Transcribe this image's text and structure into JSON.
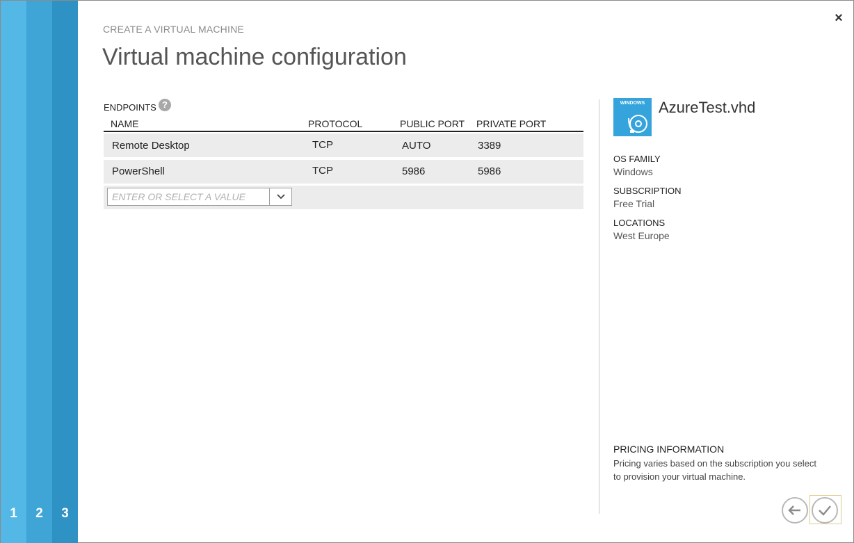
{
  "wizard": {
    "steps": [
      "1",
      "2",
      "3"
    ],
    "overtitle": "CREATE A VIRTUAL MACHINE",
    "title": "Virtual machine configuration",
    "close_glyph": "×"
  },
  "endpoints": {
    "label": "ENDPOINTS",
    "help_glyph": "?",
    "columns": [
      "NAME",
      "PROTOCOL",
      "PUBLIC PORT",
      "PRIVATE PORT"
    ],
    "rows": [
      {
        "name": "Remote Desktop",
        "protocol": "TCP",
        "public_port": "AUTO",
        "private_port": "3389"
      },
      {
        "name": "PowerShell",
        "protocol": "TCP",
        "public_port": "5986",
        "private_port": "5986"
      }
    ],
    "new_entry": {
      "placeholder": "ENTER OR SELECT A VALUE",
      "value": ""
    }
  },
  "image_info": {
    "badge_label": "WINDOWS",
    "name": "AzureTest.vhd",
    "os_family_label": "OS FAMILY",
    "os_family": "Windows",
    "subscription_label": "SUBSCRIPTION",
    "subscription": "Free Trial",
    "locations_label": "LOCATIONS",
    "locations": "West Europe"
  },
  "pricing": {
    "title": "PRICING INFORMATION",
    "text": "Pricing varies based on the subscription you select to provision your virtual machine."
  },
  "colors": {
    "step1": "#54b8e6",
    "step2": "#3fa5d6",
    "step3": "#2f92c4",
    "os_badge": "#36a4dc"
  },
  "icons": {
    "close": "close-icon",
    "help": "help-icon",
    "dropdown": "chevron-down-icon",
    "os": "windows-disk-icon",
    "back": "back-arrow-icon",
    "finish": "checkmark-icon"
  }
}
